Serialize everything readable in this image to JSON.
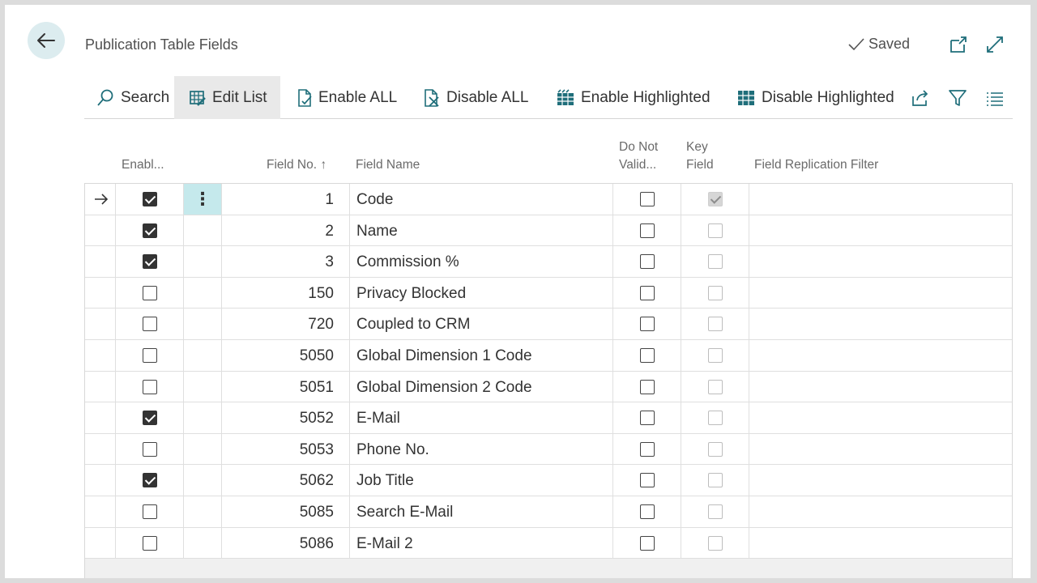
{
  "header": {
    "title": "Publication Table Fields",
    "saved_label": "Saved"
  },
  "toolbar": {
    "search": "Search",
    "edit_list": "Edit List",
    "enable_all": "Enable ALL",
    "disable_all": "Disable ALL",
    "enable_highlighted": "Enable Highlighted",
    "disable_highlighted": "Disable Highlighted"
  },
  "columns": {
    "enabled": "Enabl...",
    "field_no": "Field No. ↑",
    "field_name": "Field Name",
    "do_not_validate_1": "Do Not",
    "do_not_validate_2": "Valid...",
    "key_field_1": "Key",
    "key_field_2": "Field",
    "filter": "Field Replication Filter"
  },
  "rows": [
    {
      "no": "1",
      "name": "Code",
      "enabled": true,
      "dnv": false,
      "key": true,
      "current": true
    },
    {
      "no": "2",
      "name": "Name",
      "enabled": true,
      "dnv": false,
      "key": false
    },
    {
      "no": "3",
      "name": "Commission %",
      "enabled": true,
      "dnv": false,
      "key": false
    },
    {
      "no": "150",
      "name": "Privacy Blocked",
      "enabled": false,
      "dnv": false,
      "key": false
    },
    {
      "no": "720",
      "name": "Coupled to CRM",
      "enabled": false,
      "dnv": false,
      "key": false
    },
    {
      "no": "5050",
      "name": "Global Dimension 1 Code",
      "enabled": false,
      "dnv": false,
      "key": false
    },
    {
      "no": "5051",
      "name": "Global Dimension 2 Code",
      "enabled": false,
      "dnv": false,
      "key": false
    },
    {
      "no": "5052",
      "name": "E-Mail",
      "enabled": true,
      "dnv": false,
      "key": false
    },
    {
      "no": "5053",
      "name": "Phone No.",
      "enabled": false,
      "dnv": false,
      "key": false
    },
    {
      "no": "5062",
      "name": "Job Title",
      "enabled": true,
      "dnv": false,
      "key": false
    },
    {
      "no": "5085",
      "name": "Search E-Mail",
      "enabled": false,
      "dnv": false,
      "key": false
    },
    {
      "no": "5086",
      "name": "E-Mail 2",
      "enabled": false,
      "dnv": false,
      "key": false
    }
  ],
  "colors": {
    "accent": "#c5e9ec",
    "back_button_bg": "#dcecef",
    "icon_teal": "#1f6e7a"
  },
  "icons": {
    "back": "arrow-left-icon",
    "saved": "checkmark-icon",
    "open_new_window": "open-in-new-icon",
    "expand": "expand-icon",
    "search": "search-icon",
    "edit_list": "edit-grid-icon",
    "enable_all": "document-check-icon",
    "disable_all": "document-x-icon",
    "enable_highlighted": "grid-enable-icon",
    "disable_highlighted": "grid-disable-icon",
    "share": "share-icon",
    "filter": "filter-icon",
    "list": "list-icon"
  }
}
